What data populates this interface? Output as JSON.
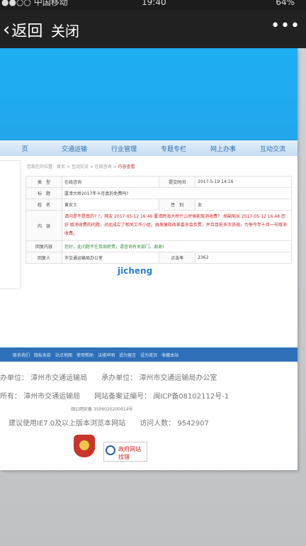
{
  "status": {
    "carrier": "●●○○ 中国移动",
    "time": "19:40",
    "battery": "64%"
  },
  "nav": {
    "back": "返回",
    "close": "关闭",
    "more": "•••"
  },
  "site": {
    "menu": [
      "页",
      "交通运输",
      "行业管理",
      "专题专栏",
      "网上办事",
      "互动交流"
    ],
    "crumb": {
      "prefix": "您现在的位置：首页 > 互动交流 > 在线咨询 > ",
      "current": "内容查看"
    },
    "rows": [
      {
        "l1": "类　型",
        "v1": "在线咨询",
        "l2": "提交时间",
        "v2": "2017-5-19 14:16"
      },
      {
        "l1": "标　题",
        "v1": "厦漳大桥2017年十月真的免费吗?"
      },
      {
        "l1": "姓　名",
        "v1": "黄女士",
        "l2": "性　别",
        "v2": "女"
      },
      {
        "l1": "内　容",
        "v1": "请问是不是真的? ?，网友 2017-05-12 16:46 厦漳跨海大桥什么时候能取消收费？ 胡副局长 2017-05-12 16:48 您好 取消收费的问题，对此成立了相关工作小组，由发展和改革委员会负责，并且目前多次协调，力争今年十月一号取消收费。"
      },
      {
        "l1": "回复内容",
        "v1": "您好，此问题不在我局职责，请咨询有关部门，谢谢!"
      },
      {
        "l1": "回复人",
        "v1": "市交通运输局办公室",
        "l2": "点击率",
        "v2": "2362"
      }
    ],
    "footer_links": [
      "联系我们",
      "隐私条款",
      "站点地图",
      "使用帮助",
      "法律声明",
      "适为留言",
      "设为首页",
      "收藏本站"
    ],
    "footer_lines": [
      "办单位：  漳州市交通运输局　　承办单位：  漳州市交通运输局办公室",
      "所有：  漳州市交通运输局　　网站备案证编号：  闽ICP备08102112号-1",
      "闽公网安备 3506020200014号",
      "建议使用IE7.0及以上版本浏览本网站　　访问人数：  9542907"
    ],
    "zf_logo": "政府网站 找错"
  },
  "watermark": "jicheng"
}
